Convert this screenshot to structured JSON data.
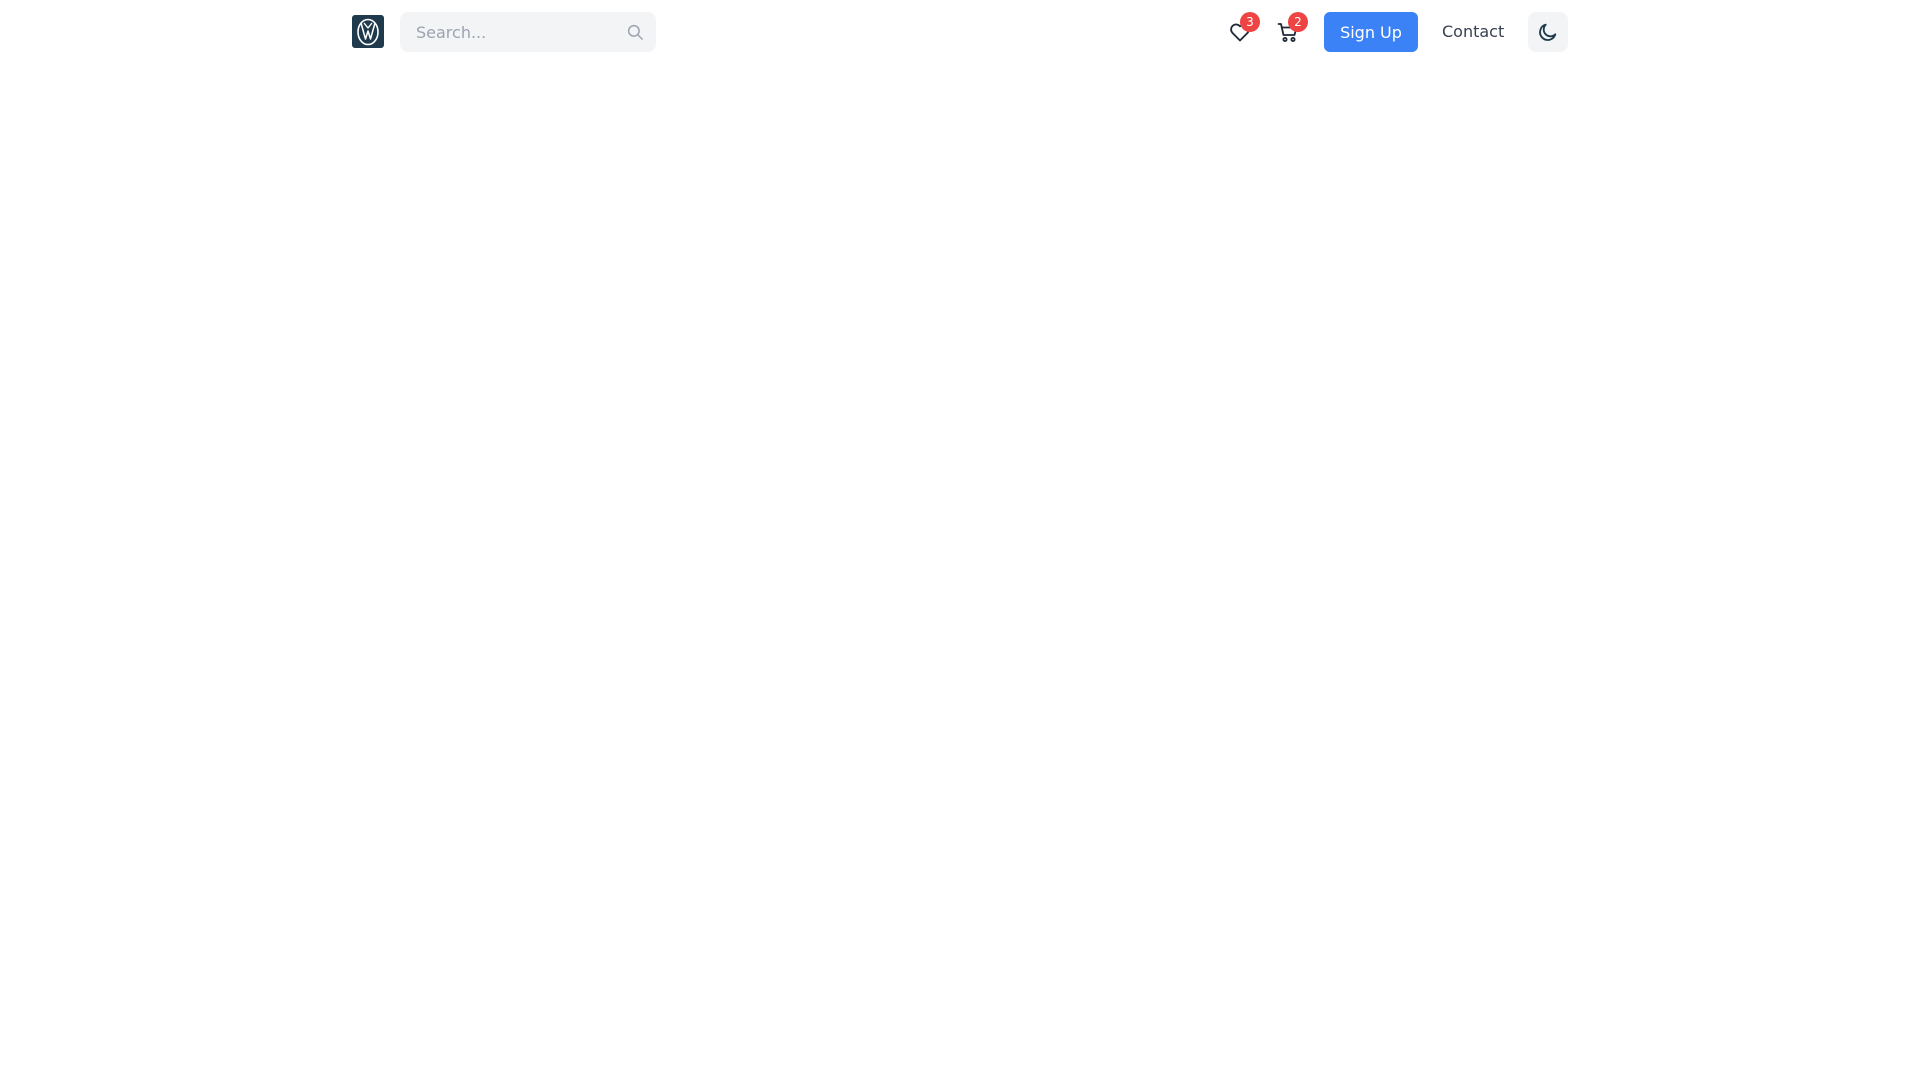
{
  "navbar": {
    "logo_icon": "vw-logo-icon",
    "search": {
      "placeholder": "Search...",
      "value": "",
      "icon": "search-icon"
    },
    "wishlist": {
      "icon": "heart-icon",
      "count": "3"
    },
    "cart": {
      "icon": "cart-icon",
      "count": "2"
    },
    "signup_label": "Sign Up",
    "contact_label": "Contact",
    "theme_toggle_icon": "moon-icon"
  },
  "colors": {
    "primary": "#3b82f6",
    "badge": "#ef4444",
    "logo_bg": "#1e3a4c",
    "text": "#374151",
    "muted": "#9ca3af",
    "input_bg": "#f3f4f6"
  }
}
